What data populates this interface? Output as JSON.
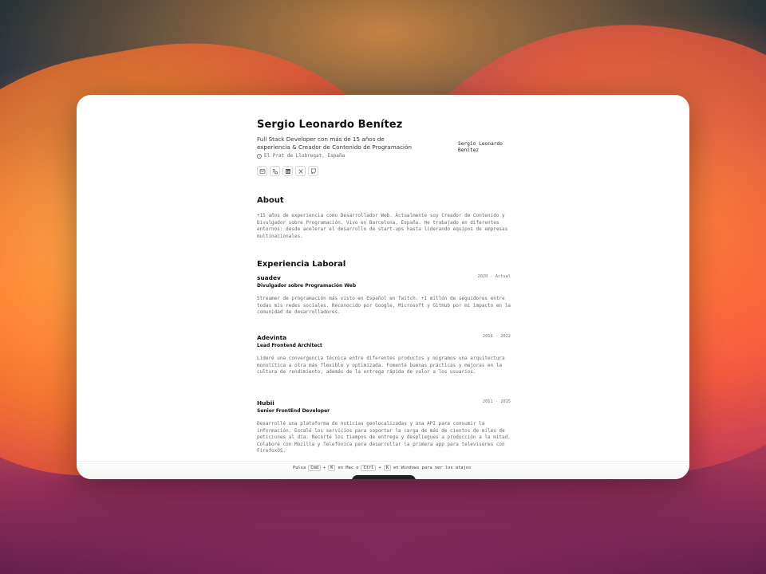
{
  "profile": {
    "name": "Sergio Leonardo Benítez",
    "headline": "Full Stack Developer con más de 15 años de experiencia & Creador de Contenido de Programación",
    "location": "El Prat de Llobregat, España",
    "avatar_alt": "Sergio Leonardo Benítez"
  },
  "contact_icons": [
    {
      "name": "mail-icon"
    },
    {
      "name": "phone-icon"
    },
    {
      "name": "linkedin-icon"
    },
    {
      "name": "x-icon"
    },
    {
      "name": "github-icon"
    }
  ],
  "about": {
    "title": "About",
    "text": "+15 años de experiencia como Desarrollador Web. Actualmente soy Creador de Contenido y Divulgador sobre Programación. Vivo en Barcelona, España. He trabajado en diferentes entornos: desde acelerar el desarrollo de start-ups hasta liderando equipos de empresas multinacionales."
  },
  "experience": {
    "title": "Experiencia Laboral",
    "jobs": [
      {
        "company": "suadev",
        "role": "Divulgador sobre Programación Web",
        "dates": "2020 - Actual",
        "description": "Streamer de programación más visto en Español en Twitch. +1 millón de seguidores entre todas mis redes sociales. Reconocido por Google, Microsoft y GitHub por mi impacto en la comunidad de desarrolladores."
      },
      {
        "company": "Adevinta",
        "role": "Lead Frontend Architect",
        "dates": "2016 - 2022",
        "description": "Lideré una convergencia técnica entre diferentes productos y migramos una arquitectura monolítica a otra más flexible y optimizada. Fomenté buenas prácticas y mejoras en la cultura de rendimiento, además de la entrega rápida de valor a los usuarios."
      },
      {
        "company": "Hubii",
        "role": "Senior FrontEnd Developer",
        "dates": "2011 - 2015",
        "description": "Desarrollé una plataforma de noticias geolocalizadas y una API para consumir la información. Escalé los servicios para soportar la carga de más de cientos de miles de peticiones al día. Recorté los tiempos de entrega y despliegues a producción a la mitad. Colaboré con Mozilla y Telefónica para desarrollar la primera app para televisores con FirefoxOS."
      }
    ]
  },
  "footer": {
    "press": "Pulsa",
    "cmd": "Cmd",
    "plus1": "+",
    "k1": "K",
    "on_mac": "en Mac o",
    "ctrl": "Ctrl",
    "plus2": "+",
    "k2": "K",
    "on_windows": "en Windows para ver los atajos"
  }
}
